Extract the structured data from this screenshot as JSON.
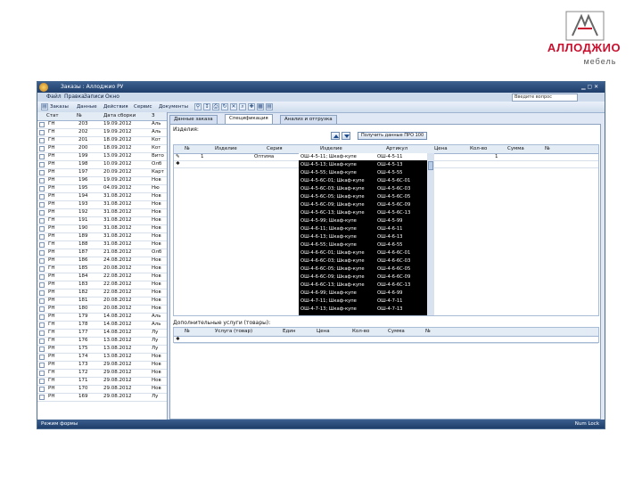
{
  "brand": {
    "name": "АЛЛОДЖИО",
    "sub": "мебель"
  },
  "window": {
    "title": "Заказы : Аллоджио РУ"
  },
  "ribbon": {
    "items": [
      "Файл",
      "Правка",
      "Записи",
      "Окно"
    ],
    "search_placeholder": "Введите вопрос"
  },
  "toolbar": {
    "items": [
      "Заказы",
      "Данные",
      "Действия",
      "Сервис",
      "Документы"
    ]
  },
  "left_grid": {
    "headers": [
      "Стат",
      "№",
      "Дата сборки",
      "З"
    ],
    "rows": [
      [
        "ГН",
        "203",
        "19.09.2012",
        "Аль"
      ],
      [
        "ГН",
        "202",
        "19.09.2012",
        "Аль"
      ],
      [
        "ГН",
        "201",
        "18.09.2012",
        "Кот"
      ],
      [
        "РН",
        "200",
        "18.09.2012",
        "Кот"
      ],
      [
        "РН",
        "199",
        "13.09.2012",
        "Вито"
      ],
      [
        "РН",
        "198",
        "10.09.2012",
        "Олб"
      ],
      [
        "РН",
        "197",
        "20.09.2012",
        "Карт"
      ],
      [
        "РН",
        "196",
        "19.09.2012",
        "Нов"
      ],
      [
        "РН",
        "195",
        "04.09.2012",
        "Ню"
      ],
      [
        "РН",
        "194",
        "31.08.2012",
        "Нов"
      ],
      [
        "РН",
        "193",
        "31.08.2012",
        "Нов"
      ],
      [
        "РН",
        "192",
        "31.08.2012",
        "Нов"
      ],
      [
        "ГН",
        "191",
        "31.08.2012",
        "Нов"
      ],
      [
        "РН",
        "190",
        "31.08.2012",
        "Нов"
      ],
      [
        "РН",
        "189",
        "31.08.2012",
        "Нов"
      ],
      [
        "ГН",
        "188",
        "31.08.2012",
        "Нов"
      ],
      [
        "РН",
        "187",
        "21.08.2012",
        "Олб"
      ],
      [
        "РН",
        "186",
        "24.08.2012",
        "Нов"
      ],
      [
        "ГН",
        "185",
        "20.08.2012",
        "Нов"
      ],
      [
        "РН",
        "184",
        "22.08.2012",
        "Нов"
      ],
      [
        "РН",
        "183",
        "22.08.2012",
        "Нов"
      ],
      [
        "РН",
        "182",
        "22.08.2012",
        "Нов"
      ],
      [
        "РН",
        "181",
        "20.08.2012",
        "Нов"
      ],
      [
        "РН",
        "180",
        "20.08.2012",
        "Нов"
      ],
      [
        "РН",
        "179",
        "14.08.2012",
        "Аль"
      ],
      [
        "ГН",
        "178",
        "14.08.2012",
        "Аль"
      ],
      [
        "ГН",
        "177",
        "14.08.2012",
        "Лу"
      ],
      [
        "ГН",
        "176",
        "13.08.2012",
        "Лу"
      ],
      [
        "РН",
        "175",
        "13.08.2012",
        "Лу"
      ],
      [
        "РН",
        "174",
        "13.08.2012",
        "Нов"
      ],
      [
        "РН",
        "173",
        "29.08.2012",
        "Нов"
      ],
      [
        "ГН",
        "172",
        "29.08.2012",
        "Нов"
      ],
      [
        "ГН",
        "171",
        "29.08.2012",
        "Нов"
      ],
      [
        "РН",
        "170",
        "29.08.2012",
        "Нов"
      ],
      [
        "РН",
        "169",
        "29.08.2012",
        "Лу"
      ]
    ]
  },
  "tabs": [
    "Данные заказа",
    "Спецификация",
    "Анализ и отгрузка"
  ],
  "panel": {
    "label": "Изделия:",
    "btn_get": "Получить данные ПРО 100",
    "sub1_headers": [
      "№",
      "Изделие",
      "Серия",
      "Изделие",
      "Артикул",
      "Цена",
      "Кол-во",
      "Сумма",
      "№"
    ],
    "sub1_row": {
      "num": "1",
      "series": "Оптима",
      "qty": "1"
    },
    "sub2_label": "Дополнительные услуги (товары):",
    "sub2_headers": [
      "№",
      "Услуга (товар)",
      "Един",
      "Цена",
      "Кол-во",
      "Сумма",
      "№"
    ]
  },
  "dropdown": [
    [
      "ОШ-4-5-11; Шкаф-купе",
      "ОШ-4-5-11"
    ],
    [
      "ОШ-4-5-13; Шкаф-купе",
      "ОШ-4-5-13"
    ],
    [
      "ОШ-4-5-55; Шкаф-купе",
      "ОШ-4-5-55"
    ],
    [
      "ОШ-4-5-6С-01; Шкаф-купе",
      "ОШ-4-5-6С-01"
    ],
    [
      "ОШ-4-5-6С-03; Шкаф-купе",
      "ОШ-4-5-6С-03"
    ],
    [
      "ОШ-4-5-6С-05; Шкаф-купе",
      "ОШ-4-5-6С-05"
    ],
    [
      "ОШ-4-5-6С-09; Шкаф-купе",
      "ОШ-4-5-6С-09"
    ],
    [
      "ОШ-4-5-6С-13; Шкаф-купе",
      "ОШ-4-5-6С-13"
    ],
    [
      "ОШ-4-5-99; Шкаф-купе",
      "ОШ-4-5-99"
    ],
    [
      "ОШ-4-6-11; Шкаф-купе",
      "ОШ-4-6-11"
    ],
    [
      "ОШ-4-6-13; Шкаф-купе",
      "ОШ-4-6-13"
    ],
    [
      "ОШ-4-6-55; Шкаф-купе",
      "ОШ-4-6-55"
    ],
    [
      "ОШ-4-6-6С-01; Шкаф-купе",
      "ОШ-4-6-6С-01"
    ],
    [
      "ОШ-4-6-6С-03; Шкаф-купе",
      "ОШ-4-6-6С-03"
    ],
    [
      "ОШ-4-6-6С-05; Шкаф-купе",
      "ОШ-4-6-6С-05"
    ],
    [
      "ОШ-4-6-6С-09; Шкаф-купе",
      "ОШ-4-6-6С-09"
    ],
    [
      "ОШ-4-6-6С-13; Шкаф-купе",
      "ОШ-4-6-6С-13"
    ],
    [
      "ОШ-4-6-99; Шкаф-купе",
      "ОШ-4-6-99"
    ],
    [
      "ОШ-4-7-11; Шкаф-купе",
      "ОШ-4-7-11"
    ],
    [
      "ОШ-4-7-13; Шкаф-купе",
      "ОШ-4-7-13"
    ]
  ],
  "status": {
    "left": "Режим формы",
    "right": "Num Lock"
  }
}
